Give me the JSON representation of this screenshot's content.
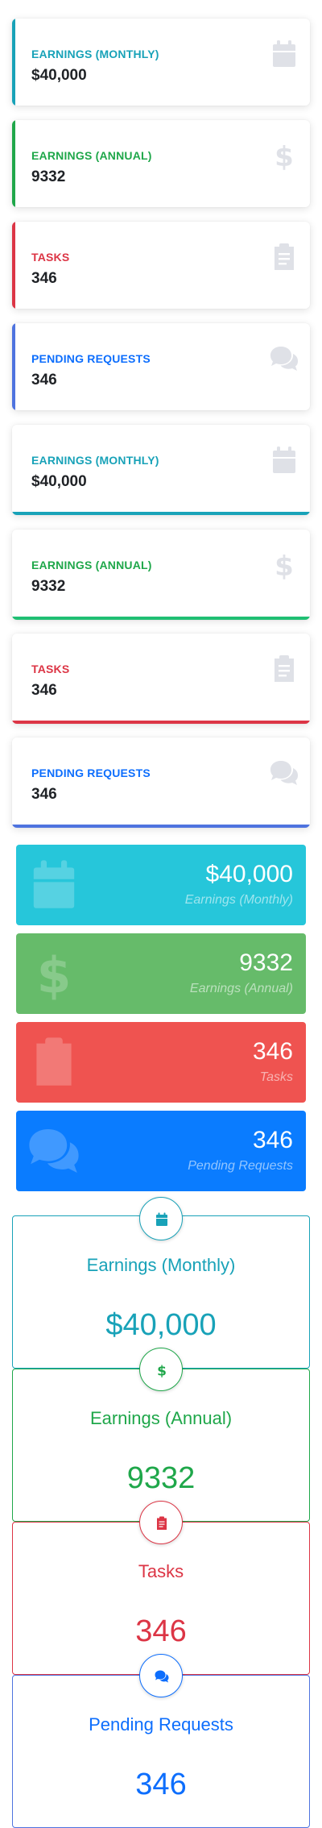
{
  "colors": {
    "teal": "#18a2b8",
    "green": "#1fa74a",
    "red": "#dc3545",
    "blue": "#0d6efd",
    "tile_teal": "#26c6da",
    "tile_green": "#66bb6a",
    "tile_red": "#ef5350",
    "tile_blue": "#0a7cff",
    "icon_gray": "#dfe1e7"
  },
  "left_border_cards": [
    {
      "label": "EARNINGS (MONTHLY)",
      "value": "$40,000",
      "icon": "calendar-icon"
    },
    {
      "label": "EARNINGS (ANNUAL)",
      "value": "9332",
      "icon": "dollar-icon"
    },
    {
      "label": "TASKS",
      "value": "346",
      "icon": "clipboard-icon"
    },
    {
      "label": "PENDING REQUESTS",
      "value": "346",
      "icon": "comments-icon"
    }
  ],
  "bottom_border_cards": [
    {
      "label": "EARNINGS (MONTHLY)",
      "value": "$40,000",
      "icon": "calendar-icon"
    },
    {
      "label": "EARNINGS (ANNUAL)",
      "value": "9332",
      "icon": "dollar-icon"
    },
    {
      "label": "TASKS",
      "value": "346",
      "icon": "clipboard-icon"
    },
    {
      "label": "PENDING REQUESTS",
      "value": "346",
      "icon": "comments-icon"
    }
  ],
  "color_tiles": [
    {
      "value": "$40,000",
      "label": "Earnings (Monthly)",
      "icon": "calendar-icon"
    },
    {
      "value": "9332",
      "label": "Earnings (Annual)",
      "icon": "dollar-icon"
    },
    {
      "value": "346",
      "label": "Tasks",
      "icon": "clipboard-icon"
    },
    {
      "value": "346",
      "label": "Pending Requests",
      "icon": "comments-icon"
    }
  ],
  "outlined_cards": [
    {
      "title": "Earnings (Monthly)",
      "value": "$40,000",
      "icon": "calendar-icon"
    },
    {
      "title": "Earnings (Annual)",
      "value": "9332",
      "icon": "dollar-icon"
    },
    {
      "title": "Tasks",
      "value": "346",
      "icon": "clipboard-icon"
    },
    {
      "title": "Pending Requests",
      "value": "346",
      "icon": "comments-icon"
    }
  ]
}
